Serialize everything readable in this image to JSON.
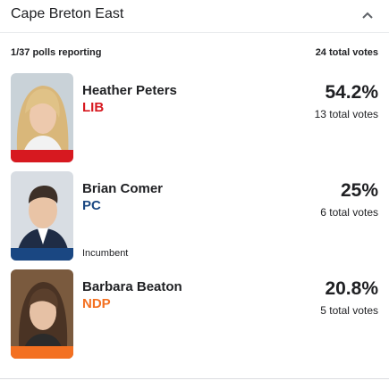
{
  "riding": {
    "name": "Cape Breton East"
  },
  "summary": {
    "polls_reporting": "1/37 polls reporting",
    "total_votes": "24 total votes"
  },
  "candidates": [
    {
      "name": "Heather Peters",
      "party": "LIB",
      "party_color": "#d71920",
      "percent": "54.2%",
      "votes": "13 total votes",
      "incumbent": ""
    },
    {
      "name": "Brian Comer",
      "party": "PC",
      "party_color": "#1a4782",
      "percent": "25%",
      "votes": "6 total votes",
      "incumbent": "Incumbent"
    },
    {
      "name": "Barbara Beaton",
      "party": "NDP",
      "party_color": "#f37021",
      "percent": "20.8%",
      "votes": "5 total votes",
      "incumbent": ""
    }
  ],
  "icons": {
    "collapse": "chevron-up-icon"
  }
}
